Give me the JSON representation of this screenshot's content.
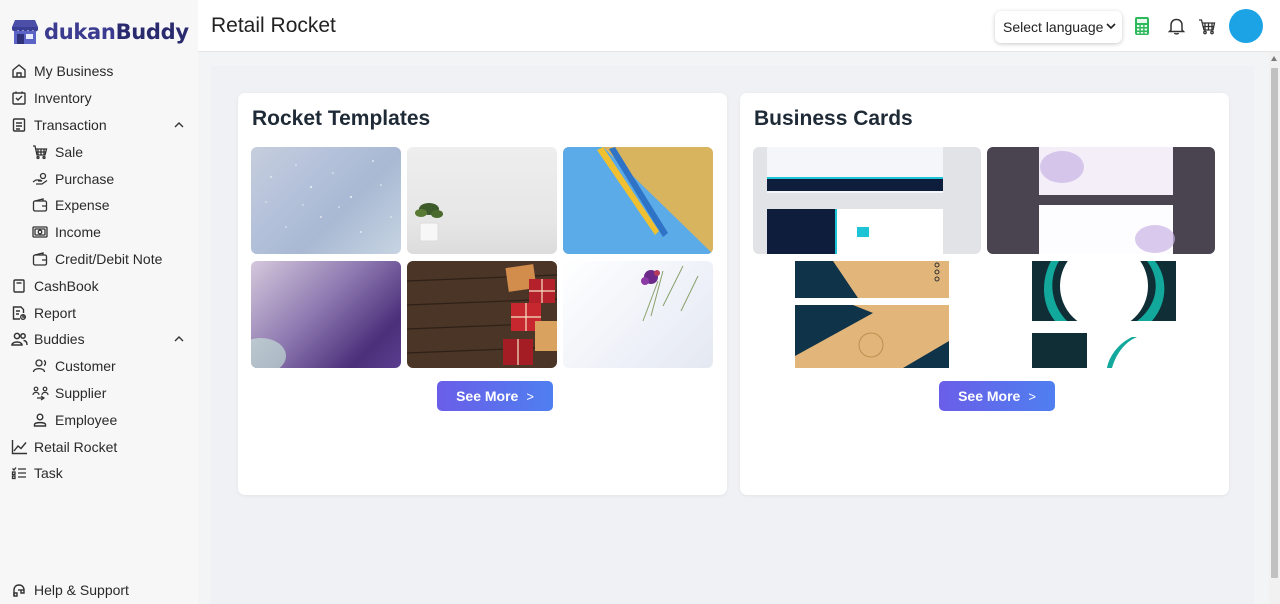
{
  "brand": {
    "part1": "dukan",
    "part2": "Buddy"
  },
  "colors": {
    "accent": "#5b6ef0",
    "avatar": "#1ba3e6",
    "calculator": "#2eb85c"
  },
  "header": {
    "title": "Retail Rocket",
    "language_select": "Select language",
    "icons": [
      "calculator-icon",
      "bell-icon",
      "cart-icon"
    ]
  },
  "sidebar": {
    "items": [
      {
        "label": "My Business",
        "icon": "home-icon",
        "level": 1
      },
      {
        "label": "Inventory",
        "icon": "inventory-icon",
        "level": 1
      },
      {
        "label": "Transaction",
        "icon": "document-icon",
        "level": 1,
        "expanded": true
      },
      {
        "label": "Sale",
        "icon": "cart-icon",
        "level": 2
      },
      {
        "label": "Purchase",
        "icon": "hand-coin-icon",
        "level": 2
      },
      {
        "label": "Expense",
        "icon": "wallet-icon",
        "level": 2
      },
      {
        "label": "Income",
        "icon": "cash-icon",
        "level": 2
      },
      {
        "label": "Credit/Debit Note",
        "icon": "wallet-icon",
        "level": 2
      },
      {
        "label": "CashBook",
        "icon": "book-icon",
        "level": 1
      },
      {
        "label": "Report",
        "icon": "report-icon",
        "level": 1
      },
      {
        "label": "Buddies",
        "icon": "users-icon",
        "level": 1,
        "expanded": true
      },
      {
        "label": "Customer",
        "icon": "customer-icon",
        "level": 2
      },
      {
        "label": "Supplier",
        "icon": "supplier-icon",
        "level": 2
      },
      {
        "label": "Employee",
        "icon": "employee-icon",
        "level": 2
      },
      {
        "label": "Retail Rocket",
        "icon": "chart-line-icon",
        "level": 1
      },
      {
        "label": "Task",
        "icon": "task-icon",
        "level": 1
      }
    ],
    "help": "Help & Support"
  },
  "cards": {
    "templates": {
      "title": "Rocket Templates",
      "button": "See More",
      "arrow": ">"
    },
    "business": {
      "title": "Business Cards",
      "button": "See More",
      "arrow": ">"
    }
  }
}
